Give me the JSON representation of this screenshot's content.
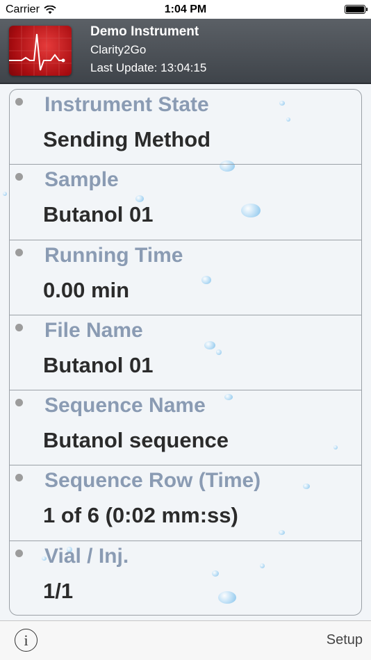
{
  "status_bar": {
    "carrier": "Carrier",
    "time": "1:04 PM"
  },
  "header": {
    "title": "Demo Instrument",
    "subtitle": "Clarity2Go",
    "last_update": "Last Update: 13:04:15",
    "icon": "ecg-monitor-icon"
  },
  "rows": [
    {
      "label": "Instrument State",
      "value": "Sending Method"
    },
    {
      "label": "Sample",
      "value": "Butanol 01"
    },
    {
      "label": "Running Time",
      "value": "0.00 min"
    },
    {
      "label": "File Name",
      "value": "Butanol 01"
    },
    {
      "label": "Sequence Name",
      "value": "Butanol sequence"
    },
    {
      "label": "Sequence Row (Time)",
      "value": "1 of 6 (0:02 mm:ss)"
    },
    {
      "label": "Vial / Inj.",
      "value": "1/1"
    }
  ],
  "toolbar": {
    "info_icon": "info-icon",
    "info_glyph": "i",
    "setup_label": "Setup"
  },
  "colors": {
    "label": "#8a9bb3",
    "value": "#2b2b2b",
    "header_bg": "#4a4f55",
    "icon_red": "#c8161c"
  }
}
